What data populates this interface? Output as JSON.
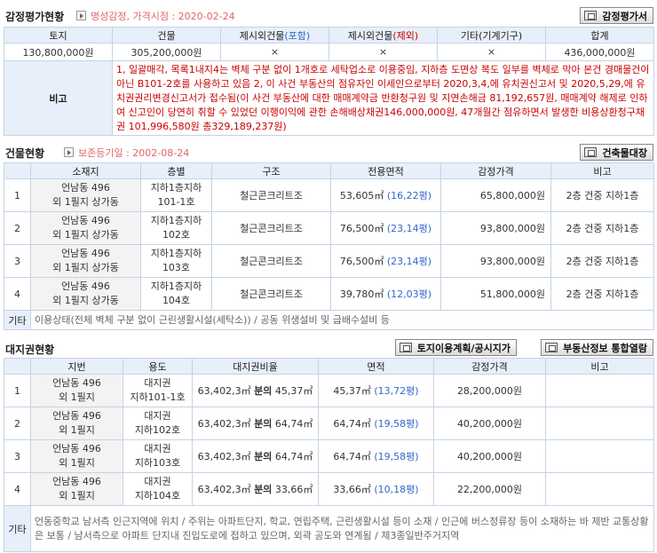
{
  "appraisal": {
    "title": "감정평가현황",
    "agency": "명성감정",
    "date_label": "가격시점 : 2020-02-24",
    "button": "감정평가서",
    "headers": [
      "토지",
      "건물",
      "제시외건물",
      "제시외건물",
      "기타(기계기구)",
      "합계"
    ],
    "hdr_incl": "(포함)",
    "hdr_excl": "(제외)",
    "values": [
      "130,800,000원",
      "305,200,000원",
      "×",
      "×",
      "×",
      "436,000,000원"
    ],
    "note_label": "비고",
    "note": "1, 일괄매각, 목록1내지4는 벽체 구분 없이 1개호로 세탁업소로 이용중임, 지하층 도면상 복도 일부를 벽체로 막아 본건 경매물건이 아닌 B101-2호를 사용하고 있음 2, 이 사건 부동산의 점유자인 이세인으로부터 2020,3,4,에 유치권신고서 및 2020,5,29,에 유치권권리변경신고서가 접수됨(이 사건 부동산에 대한 매매계약금 반환청구원 및 지연손해금 81,192,657원, 매매계약 해제로 인하여 신고인이 당연히 취할 수 있었던 이행이익에 관한 손해배상채권146,000,000원, 47개월간 점유하면서 발생한 비용상환청구채권 101,996,580원 총329,189,237원)"
  },
  "building": {
    "title": "건물현황",
    "reg_date": "보존등기일 : 2002-08-24",
    "button": "건축물대장",
    "headers": [
      "소재지",
      "층별",
      "구조",
      "전용면적",
      "감정가격",
      "비고"
    ],
    "rows": [
      {
        "no": "1",
        "loc1": "언남동 496",
        "loc2": "외 1필지 상가동",
        "floor1": "지하1층지하",
        "floor2": "101-1호",
        "structure": "철근콘크리트조",
        "area": "53,605㎡",
        "pyeong": "(16,22평)",
        "price": "65,800,000원",
        "note": "2층 건중 지하1층"
      },
      {
        "no": "2",
        "loc1": "언남동 496",
        "loc2": "외 1필지 상가동",
        "floor1": "지하1층지하",
        "floor2": "102호",
        "structure": "철근콘크리트조",
        "area": "76,500㎡",
        "pyeong": "(23,14평)",
        "price": "93,800,000원",
        "note": "2층 건중 지하1층"
      },
      {
        "no": "3",
        "loc1": "언남동 496",
        "loc2": "외 1필지 상가동",
        "floor1": "지하1층지하",
        "floor2": "103호",
        "structure": "철근콘크리트조",
        "area": "76,500㎡",
        "pyeong": "(23,14평)",
        "price": "93,800,000원",
        "note": "2층 건중 지하1층"
      },
      {
        "no": "4",
        "loc1": "언남동 496",
        "loc2": "외 1필지 상가동",
        "floor1": "지하1층지하",
        "floor2": "104호",
        "structure": "철근콘크리트조",
        "area": "39,780㎡",
        "pyeong": "(12,03평)",
        "price": "51,800,000원",
        "note": "2층 건중 지하1층"
      }
    ],
    "etc_label": "기타",
    "etc": "이용상태(전체 벽체 구분 없이 근린생활시설(세탁소)) / 공동 위생설비 및 급배수설비 등"
  },
  "land": {
    "title": "대지권현황",
    "button1": "토지이용계획/공시지가",
    "button2": "부동산정보 통합열람",
    "headers": [
      "지번",
      "용도",
      "대지권비율",
      "면적",
      "감정가격",
      "비고"
    ],
    "rows": [
      {
        "no": "1",
        "lot1": "언남동 496",
        "lot2": "외 1필지",
        "use1": "대지권",
        "use2": "지하101-1호",
        "total": "63,402,3㎡",
        "bun": "분의",
        "share": "45,37㎡",
        "area": "45,37㎡",
        "pyeong": "(13,72평)",
        "price": "28,200,000원"
      },
      {
        "no": "2",
        "lot1": "언남동 496",
        "lot2": "외 1필지",
        "use1": "대지권",
        "use2": "지하102호",
        "total": "63,402,3㎡",
        "bun": "분의",
        "share": "64,74㎡",
        "area": "64,74㎡",
        "pyeong": "(19,58평)",
        "price": "40,200,000원"
      },
      {
        "no": "3",
        "lot1": "언남동 496",
        "lot2": "외 1필지",
        "use1": "대지권",
        "use2": "지하103호",
        "total": "63,402,3㎡",
        "bun": "분의",
        "share": "64,74㎡",
        "area": "64,74㎡",
        "pyeong": "(19,58평)",
        "price": "40,200,000원"
      },
      {
        "no": "4",
        "lot1": "언남동 496",
        "lot2": "외 1필지",
        "use1": "대지권",
        "use2": "지하104호",
        "total": "63,402,3㎡",
        "bun": "분의",
        "share": "33,66㎡",
        "area": "33,66㎡",
        "pyeong": "(10,18평)",
        "price": "22,200,000원"
      }
    ],
    "etc_label": "기타",
    "etc": "언동중학교 남서측 인근지역에 위치 / 주위는 아파트단지, 학교, 연립주택, 근린생활시설 등이 소재 / 인근에 버스정류장 등이 소재하는 바 제반 교통상황은 보통 / 남서측으로 아파트 단지내 진입도로에 접하고 있으며, 외곽 공도와 연계됨 / 제3종일반주거지역"
  }
}
